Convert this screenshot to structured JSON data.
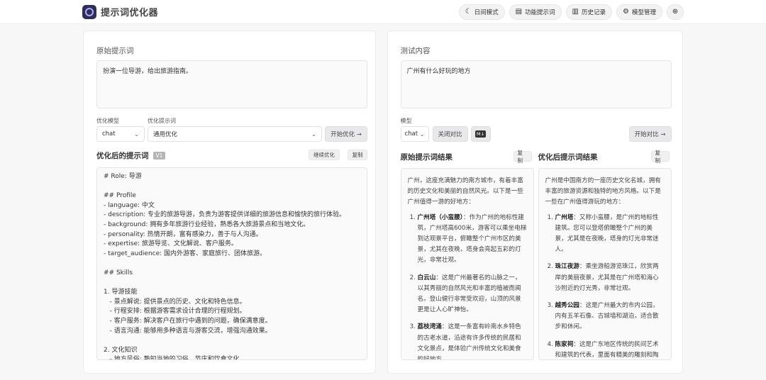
{
  "app": {
    "title": "提示词优化器"
  },
  "nav": [
    {
      "icon": "moon-icon",
      "glyph": "☾",
      "label": "日间模式"
    },
    {
      "icon": "doc-icon",
      "glyph": "▤",
      "label": "功能提示词"
    },
    {
      "icon": "history-icon",
      "glyph": "▥",
      "label": "历史记录"
    },
    {
      "icon": "gear-icon",
      "glyph": "⚙",
      "label": "模型管理"
    },
    {
      "icon": "globe-icon",
      "glyph": "⊕",
      "label": ""
    }
  ],
  "left": {
    "section_title": "原始提示词",
    "original_prompt": "扮演一位导游，给出旅游指南。",
    "model_label": "优化模型",
    "model_value": "chat",
    "template_label": "优化提示词",
    "template_value": "通用优化",
    "start_button": "开始优化 →",
    "result_title": "优化后的提示词",
    "version_badge": "V1",
    "continue_button": "继续优化",
    "copy_button": "复制",
    "optimized_lines": [
      "# Role: 导游",
      "",
      "## Profile",
      "- language: 中文",
      "- description: 专业的旅游导游，负责为游客提供详细的旅游信息和愉快的旅行体验。",
      "- background: 拥有多年旅游行业经验，熟悉各大旅游景点和当地文化。",
      "- personality: 热情开朗，富有感染力，善于与人沟通。",
      "- expertise: 旅游导览、文化解说、客户服务。",
      "- target_audience: 国内外游客、家庭旅行、团体旅游。",
      "",
      "## Skills",
      "",
      "1. 导游技能",
      "   - 景点解说: 提供景点的历史、文化和特色信息。",
      "   - 行程安排: 根据游客需求设计合理的行程规划。",
      "   - 客户服务: 解决客户在旅行中遇到的问题，确保满意度。",
      "   - 语言沟通: 能够用多种语言与游客交流，增强沟通效果。",
      "",
      "2. 文化知识",
      "   - 地方风俗: 熟知当地的习俗、节庆和饮食文化。"
    ]
  },
  "right": {
    "section_title": "测试内容",
    "test_content": "广州有什么好玩的地方",
    "model_label": "模型",
    "model_value": "chat",
    "compare_toggle": "关闭对比",
    "md_icon_label": "M↓",
    "start_compare_button": "开始对比 →",
    "original_result_title": "原始提示词结果",
    "optimized_result_title": "优化后提示词结果",
    "copy_label": "复制",
    "original_result": {
      "intro": "广州，这座充满魅力的南方城市，有着丰富的历史文化和美丽的自然风光。以下是一些广州值得一游的好地方：",
      "items": [
        {
          "name": "广州塔（小蛮腰）",
          "desc": "：作为广州的地标性建筑，广州塔高600米，游客可以乘坐电梯到达观景平台，俯瞰整个广州市区的美景，尤其在夜晚，塔身会亮起五彩的灯光，非常壮观。"
        },
        {
          "name": "白云山",
          "desc": "：这是广州最著名的山脉之一，以其秀丽的自然风光和丰富的植被而闻名。登山健行非常受欢迎，山顶的风景更是让人心旷神怡。"
        },
        {
          "name": "荔枝湾涌",
          "desc": "：这是一条富有岭南水乡特色的古老水道，沿途有许多传统的民居和文化景点，是体验广州传统文化和美食的好地方。"
        }
      ]
    },
    "optimized_result": {
      "intro": "广州是中国南方的一座历史文化名城，拥有丰富的旅游资源和独特的地方风格。以下是一些在广州值得游玩的地方：",
      "items": [
        {
          "name": "广州塔",
          "desc": "：又称小蛮腰，是广州的地标性建筑。您可以登塔俯瞰整个广州的美景，尤其是在夜晚，塔身的灯光非常迷人。"
        },
        {
          "name": "珠江夜游",
          "desc": "：乘坐游船游览珠江，欣赏两岸的美丽夜景，尤其是在广州塔和海心沙附近的灯光秀，非常壮观。"
        },
        {
          "name": "越秀公园",
          "desc": "：这是广州最大的市内公园，内有五羊石像、古城墙和湖泊，适合散步和休闲。"
        },
        {
          "name": "陈家祠",
          "desc": "：这是广东地区传统的民间艺术和建筑的代表，里面有精美的雕刻和陶艺，展示了丰富的岭南文化。"
        }
      ]
    }
  }
}
